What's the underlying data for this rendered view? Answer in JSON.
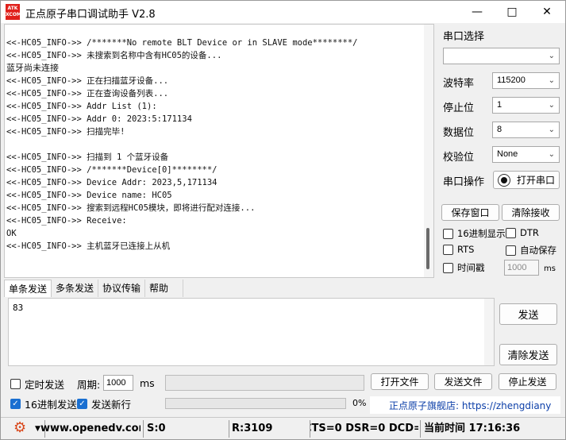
{
  "window": {
    "title": "正点原子串口调试助手 V2.8",
    "icon_text": "ATK\nXCOM",
    "buttons": [
      "minimize-icon",
      "maximize-icon",
      "close-icon"
    ]
  },
  "receive": {
    "lines": [
      "<<-HC05_INFO->> /*******No remote BLT Device or in SLAVE mode********/",
      "<<-HC05_INFO->> 未搜索到名称中含有HC05的设备...",
      "蓝牙尚未连接",
      "<<-HC05_INFO->> 正在扫描蓝牙设备...",
      "<<-HC05_INFO->> 正在查询设备列表...",
      "<<-HC05_INFO->> Addr List (1):",
      "<<-HC05_INFO->> Addr 0: 2023:5:171134",
      "<<-HC05_INFO->> 扫描完毕!",
      "",
      "<<-HC05_INFO->> 扫描到 1 个蓝牙设备",
      "<<-HC05_INFO->> /*******Device[0]********/",
      "<<-HC05_INFO->> Device Addr: 2023,5,171134",
      "<<-HC05_INFO->> Device name: HC05",
      "<<-HC05_INFO->> 搜索到远程HC05模块，即将进行配对连接...",
      "<<-HC05_INFO->> Receive:",
      "OK",
      "<<-HC05_INFO->> 主机蓝牙已连接上从机"
    ]
  },
  "port_panel": {
    "port_select_label": "串口选择",
    "port_value": "",
    "baud_label": "波特率",
    "baud_value": "115200",
    "stop_label": "停止位",
    "stop_value": "1",
    "data_label": "数据位",
    "data_value": "8",
    "parity_label": "校验位",
    "parity_value": "None",
    "op_label": "串口操作",
    "open_button": "打开串口",
    "save_window_button": "保存窗口",
    "clear_receive_button": "清除接收",
    "hex_display_label": "16进制显示",
    "dtr_label": "DTR",
    "rts_label": "RTS",
    "auto_save_label": "自动保存",
    "timestamp_label": "时间戳",
    "timestamp_value": "1000",
    "timestamp_unit": "ms"
  },
  "tabs": [
    "单条发送",
    "多条发送",
    "协议传输",
    "帮助"
  ],
  "send": {
    "text": "83",
    "send_button": "发送",
    "clear_send_button": "清除发送",
    "timed_send_label": "定时发送",
    "period_label": "周期:",
    "period_value": "1000",
    "period_unit": "ms",
    "open_file_button": "打开文件",
    "send_file_button": "发送文件",
    "stop_send_button": "停止发送",
    "hex_send_label": "16进制发送",
    "newline_label": "发送新行",
    "progress_text": "0%",
    "progress_value": 0,
    "store_text": "正点原子旗舰店: https://zhengdiany"
  },
  "status": {
    "url": "www.openedv.com",
    "sent": "S:0",
    "received": "R:3109",
    "signals": "CTS=0 DSR=0 DCD=",
    "time": "当前时间 17:16:36"
  },
  "colors": {
    "accent": "#1a6fd1",
    "icon_red": "#e0201b",
    "link_blue": "#0b3ea8"
  }
}
